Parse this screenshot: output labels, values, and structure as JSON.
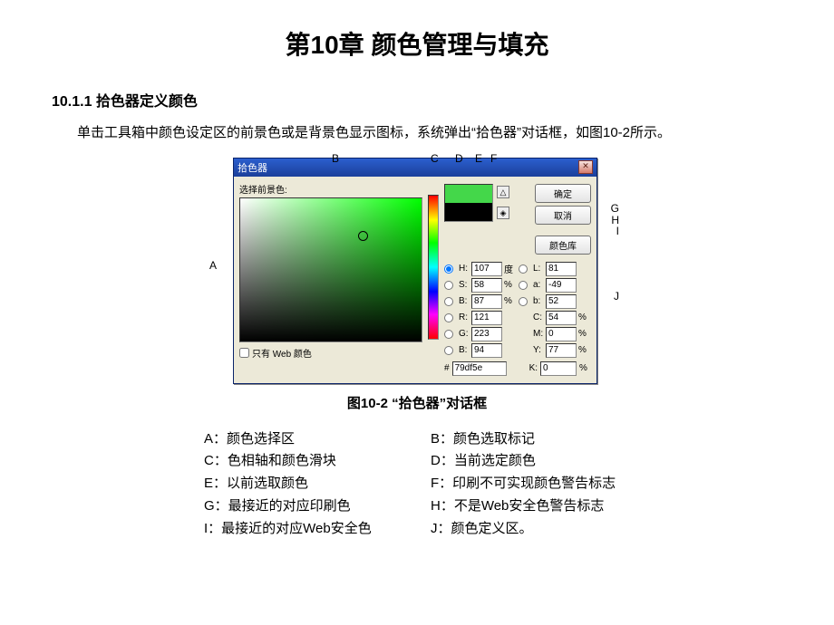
{
  "chapter_title": "第10章 颜色管理与填充",
  "section_heading": "10.1.1 拾色器定义颜色",
  "intro_text": "单击工具箱中颜色设定区的前景色或是背景色显示图标，系统弹出“拾色器”对话框，如图10-2所示。",
  "figure_caption": "图10-2 “拾色器”对话框",
  "dialog": {
    "title": "拾色器",
    "pick_label": "选择前景色:",
    "buttons": {
      "ok": "确定",
      "cancel": "取消",
      "library": "颜色库"
    },
    "web_only": "只有 Web 颜色",
    "swatches": {
      "current": "#44d74a",
      "previous": "#000000"
    },
    "fields": {
      "H": {
        "label": "H:",
        "value": "107",
        "unit": "度"
      },
      "S": {
        "label": "S:",
        "value": "58",
        "unit": "%"
      },
      "Bv": {
        "label": "B:",
        "value": "87",
        "unit": "%"
      },
      "R": {
        "label": "R:",
        "value": "121"
      },
      "G": {
        "label": "G:",
        "value": "223"
      },
      "B": {
        "label": "B:",
        "value": "94"
      },
      "L": {
        "label": "L:",
        "value": "81"
      },
      "a": {
        "label": "a:",
        "value": "-49"
      },
      "b": {
        "label": "b:",
        "value": "52"
      },
      "C": {
        "label": "C:",
        "value": "54",
        "unit": "%"
      },
      "M": {
        "label": "M:",
        "value": "0",
        "unit": "%"
      },
      "Y": {
        "label": "Y:",
        "value": "77",
        "unit": "%"
      },
      "K": {
        "label": "K:",
        "value": "0",
        "unit": "%"
      },
      "hex": {
        "label": "#",
        "value": "79df5e"
      }
    }
  },
  "callouts": {
    "A": "A",
    "B": "B",
    "C": "C",
    "D": "D",
    "E": "E",
    "F": "F",
    "G": "G",
    "H": "H",
    "I": "I",
    "J": "J"
  },
  "legend": {
    "A": "A：颜色选择区",
    "B": "B：颜色选取标记",
    "C": "C：色相轴和颜色滑块",
    "D": "D：当前选定颜色",
    "E": "E：以前选取颜色",
    "F": "F：印刷不可实现颜色警告标志",
    "G": "G：最接近的对应印刷色",
    "H": "H：不是Web安全色警告标志",
    "I": "I：最接近的对应Web安全色",
    "J": "J：颜色定义区。"
  }
}
